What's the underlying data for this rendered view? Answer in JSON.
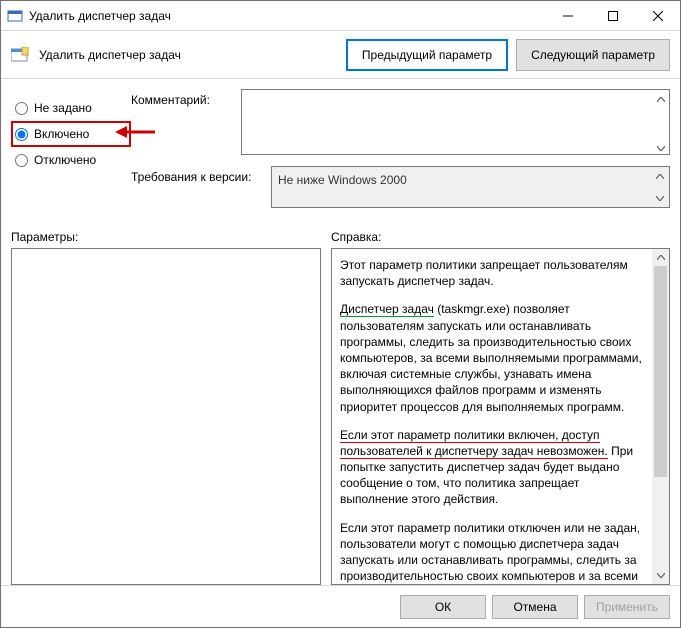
{
  "window": {
    "title": "Удалить диспетчер задач"
  },
  "header": {
    "label": "Удалить диспетчер задач",
    "prev": "Предыдущий параметр",
    "next": "Следующий параметр"
  },
  "radios": {
    "not_configured": "Не задано",
    "enabled": "Включено",
    "disabled": "Отключено",
    "selected": "enabled"
  },
  "fields": {
    "comment_label": "Комментарий:",
    "comment_value": "",
    "requirements_label": "Требования к версии:",
    "requirements_value": "Не ниже Windows 2000"
  },
  "panels": {
    "params_label": "Параметры:",
    "help_label": "Справка:"
  },
  "help": {
    "p1": "Этот параметр политики запрещает пользователям запускать диспетчер задач.",
    "p2a": "Диспетчер задач",
    "p2b": " (taskmgr.exe) позволяет пользователям запускать или останавливать программы, следить за производительностью своих компьютеров, за всеми выполняемыми программами, включая системные службы, узнавать имена выполняющихся файлов программ и изменять приоритет процессов для выполняемых программ.",
    "p3a": "Если этот параметр политики включен, доступ пользователей к диспетчеру задач невозможен.",
    "p3b": " При попытке запустить диспетчер задач будет выдано сообщение о том, что политика запрещает выполнение этого действия.",
    "p4": "Если этот параметр политики отключен или не задан, пользователи могут с помощью диспетчера задач запускать или останавливать программы, следить за производительностью своих компьютеров и за всеми выполняемыми программами, включая системные службы,"
  },
  "footer": {
    "ok": "ОК",
    "cancel": "Отмена",
    "apply": "Применить"
  }
}
